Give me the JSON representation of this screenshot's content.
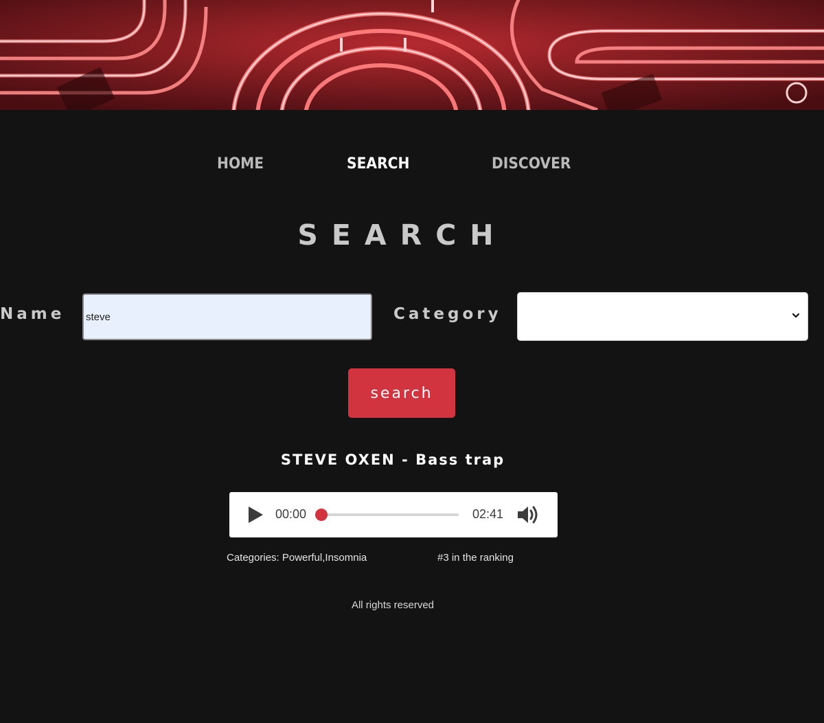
{
  "nav": {
    "items": [
      {
        "label": "HOME",
        "active": false
      },
      {
        "label": "SEARCH",
        "active": true
      },
      {
        "label": "DISCOVER",
        "active": false
      }
    ]
  },
  "page": {
    "title": "SEARCH"
  },
  "form": {
    "name_label": "Name",
    "name_value": "steve",
    "category_label": "Category",
    "category_value": "",
    "search_button": "search"
  },
  "result": {
    "title": "STEVE OXEN - Bass trap",
    "player": {
      "current_time": "00:00",
      "total_time": "02:41",
      "progress": 0
    },
    "categories": "Categories: Powerful,Insomnia",
    "ranking": "#3 in the ranking"
  },
  "footer": {
    "text": "All rights reserved"
  },
  "colors": {
    "background": "#131313",
    "accent": "#d2343f",
    "nav_inactive": "#b9b9b9",
    "nav_active": "#ffffff",
    "input_autofill": "#e8f0fe"
  },
  "icons": {
    "play": "play-icon",
    "volume": "volume-icon",
    "dropdown": "chevron-down-icon"
  }
}
